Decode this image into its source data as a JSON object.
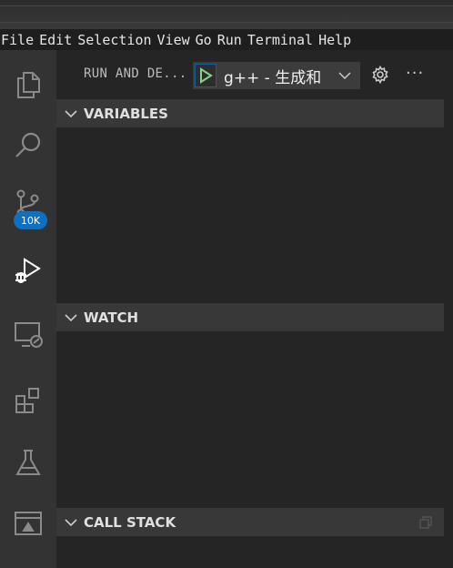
{
  "menu": {
    "items": [
      "File",
      "Edit",
      "Selection",
      "View",
      "Go",
      "Run",
      "Terminal",
      "Help"
    ]
  },
  "activity_bar": {
    "items": [
      {
        "name": "explorer-icon"
      },
      {
        "name": "search-icon"
      },
      {
        "name": "source-control-icon"
      },
      {
        "name": "run-debug-icon"
      },
      {
        "name": "remote-explorer-icon"
      },
      {
        "name": "extensions-icon"
      },
      {
        "name": "testing-icon"
      },
      {
        "name": "remote-window-icon"
      }
    ],
    "source_control_badge": "10K"
  },
  "sidebar": {
    "title": "RUN AND DE...",
    "config_name": "g++ - 生成和",
    "sections": {
      "variables": "VARIABLES",
      "watch": "WATCH",
      "call_stack": "CALL STACK"
    }
  },
  "colors": {
    "accent": "#0e70c0",
    "play_green": "#89d185",
    "activity_bg": "#333333",
    "sidebar_bg": "#252526",
    "section_header_bg": "#383838"
  }
}
